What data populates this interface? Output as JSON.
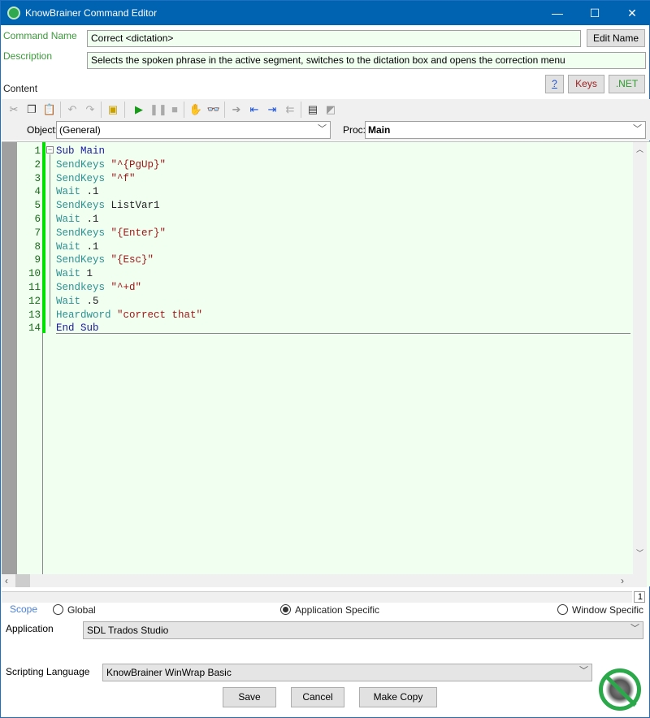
{
  "window": {
    "title": "KnowBrainer Command Editor",
    "controls": {
      "minimize": "—",
      "maximize": "☐",
      "close": "✕"
    }
  },
  "form": {
    "command_name_label": "Command Name",
    "command_name_value": "Correct <dictation>",
    "edit_name_button": "Edit Name",
    "description_label": "Description",
    "description_value": "Selects the spoken phrase in the active segment, switches to the dictation box and opens the correction menu",
    "content_label": "Content",
    "help_button": "?",
    "keys_button": "Keys",
    "net_button": ".NET"
  },
  "toolbar": {
    "icons": [
      "cut-icon",
      "copy-icon",
      "paste-icon",
      "undo-icon",
      "redo-icon",
      "references-icon",
      "run-icon",
      "pause-icon",
      "stop-icon",
      "toggle-breakpoint-icon",
      "quick-watch-icon",
      "step-into-icon",
      "step-over-icon",
      "step-out-icon",
      "step-to-cursor-icon",
      "userdialog-editor-icon",
      "browse-icon"
    ]
  },
  "object": {
    "label": "Object:",
    "value": "(General)"
  },
  "proc": {
    "label": "Proc:",
    "value": "Main"
  },
  "code": [
    [
      [
        "kw",
        "Sub Main"
      ]
    ],
    [
      [
        "fn",
        "SendKeys "
      ],
      [
        "st",
        "\"^{PgUp}\""
      ]
    ],
    [
      [
        "fn",
        "SendKeys "
      ],
      [
        "st",
        "\"^f\""
      ]
    ],
    [
      [
        "fn",
        "Wait "
      ],
      [
        "pl",
        ".1"
      ]
    ],
    [
      [
        "fn",
        "SendKeys "
      ],
      [
        "pl",
        "ListVar1"
      ]
    ],
    [
      [
        "fn",
        "Wait "
      ],
      [
        "pl",
        ".1"
      ]
    ],
    [
      [
        "fn",
        "SendKeys "
      ],
      [
        "st",
        "\"{Enter}\""
      ]
    ],
    [
      [
        "fn",
        "Wait "
      ],
      [
        "pl",
        ".1"
      ]
    ],
    [
      [
        "fn",
        "SendKeys "
      ],
      [
        "st",
        "\"{Esc}\""
      ]
    ],
    [
      [
        "fn",
        "Wait "
      ],
      [
        "pl",
        "1"
      ]
    ],
    [
      [
        "fn",
        "Sendkeys "
      ],
      [
        "st",
        "\"^+d\""
      ]
    ],
    [
      [
        "fn",
        "Wait "
      ],
      [
        "pl",
        ".5"
      ]
    ],
    [
      [
        "fn",
        "Heardword "
      ],
      [
        "st",
        "\"correct that\""
      ]
    ],
    [
      [
        "kw",
        "End Sub"
      ]
    ]
  ],
  "status": {
    "line": "1"
  },
  "scope": {
    "label": "Scope",
    "options": [
      {
        "label": "Global",
        "selected": false
      },
      {
        "label": "Application Specific",
        "selected": true
      },
      {
        "label": "Window Specific",
        "selected": false
      }
    ]
  },
  "application": {
    "label": "Application",
    "value": "SDL Trados Studio"
  },
  "scripting": {
    "label": "Scripting Language",
    "value": "KnowBrainer WinWrap Basic"
  },
  "buttons": {
    "save": "Save",
    "cancel": "Cancel",
    "make_copy": "Make Copy"
  },
  "colors": {
    "title_bar": "#0063b1",
    "editor_bg": "#f0fff0",
    "label_green": "#3a9a3a",
    "keys_red": "#a02020",
    "net_green": "#2a9a2a"
  }
}
